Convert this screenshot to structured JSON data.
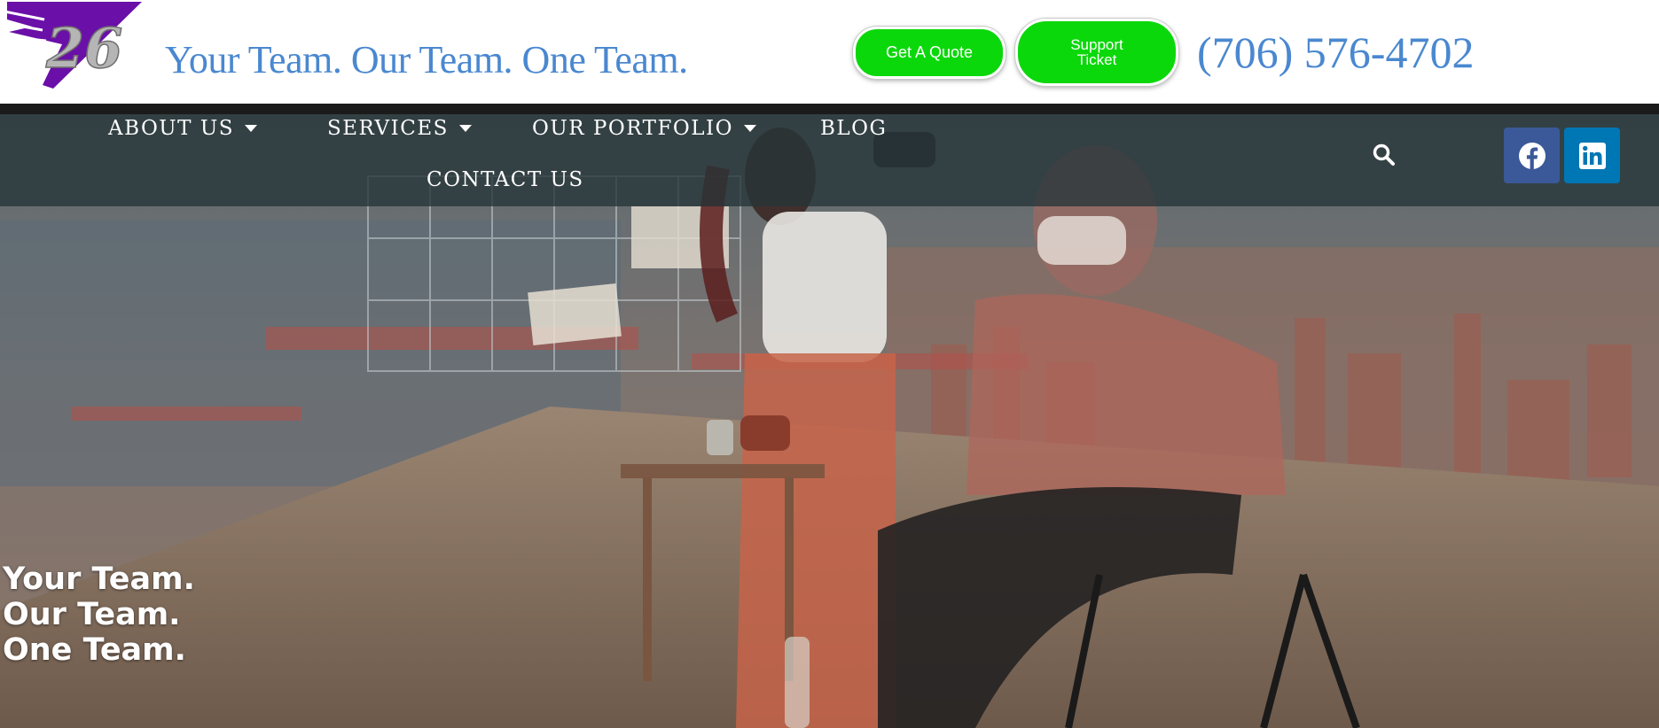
{
  "header": {
    "logo_text": "26",
    "tagline": "Your Team. Our Team. One Team.",
    "quote_button": "Get A Quote",
    "support_button_line1": "Support",
    "support_button_line2": "Ticket",
    "phone": "(706) 576-4702"
  },
  "nav": {
    "items": [
      {
        "label": "ABOUT US"
      },
      {
        "label": "SERVICES"
      },
      {
        "label": "OUR PORTFOLIO"
      },
      {
        "label": "BLOG"
      },
      {
        "label": "CONTACT US"
      }
    ]
  },
  "icons": {
    "search": "search-icon",
    "facebook": "facebook-icon",
    "linkedin": "linkedin-icon"
  },
  "hero": {
    "line1": "Your Team.",
    "line2": "Our Team.",
    "line3": "One Team."
  },
  "colors": {
    "brand_blue": "#4a88d0",
    "button_green": "#0bd80b",
    "logo_purple": "#6a0fa8",
    "facebook": "#3b5998",
    "linkedin": "#0077b5"
  }
}
